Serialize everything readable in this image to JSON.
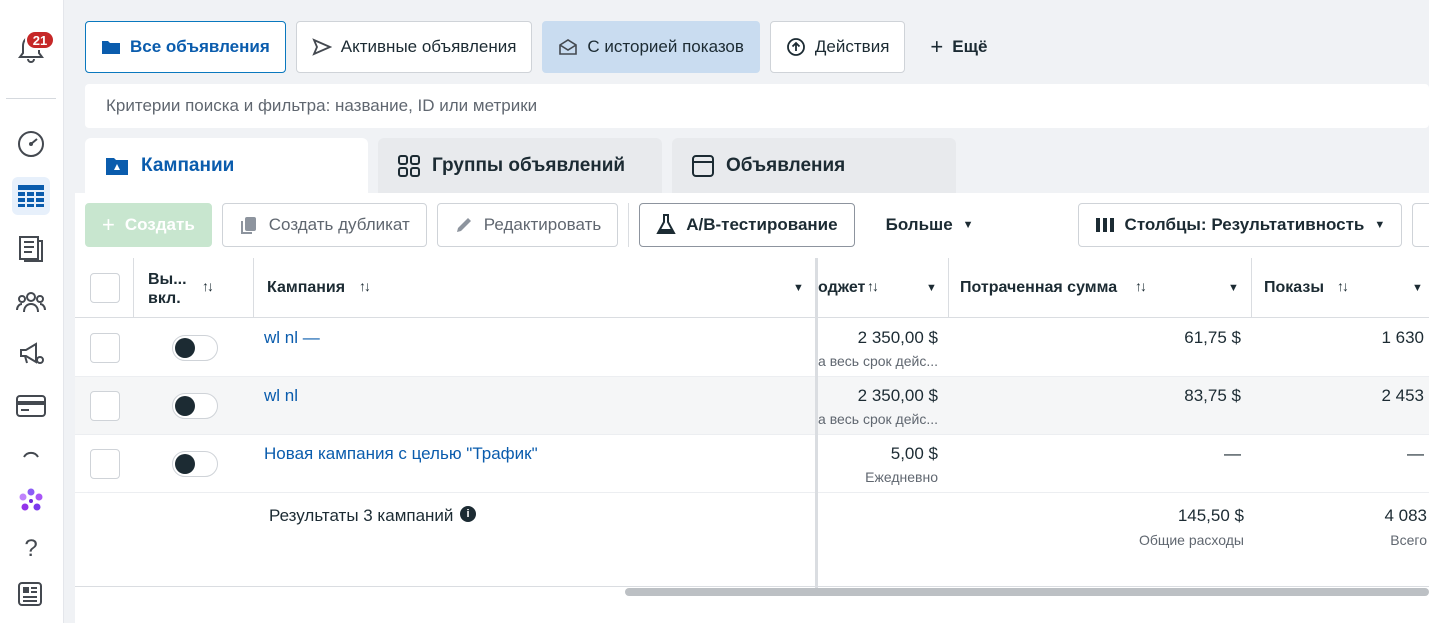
{
  "rail": {
    "notification_count": "21"
  },
  "view_tabs": [
    {
      "label": "Все объявления"
    },
    {
      "label": "Активные объявления"
    },
    {
      "label": "С историей показов"
    },
    {
      "label": "Действия"
    },
    {
      "label": "Ещё"
    }
  ],
  "search": {
    "placeholder": "Критерии поиска и фильтра: название, ID или метрики"
  },
  "level_tabs": [
    {
      "label": "Кампании"
    },
    {
      "label": "Группы объявлений"
    },
    {
      "label": "Объявления"
    }
  ],
  "toolbar": {
    "create_label": "Создать",
    "duplicate_label": "Создать дубликат",
    "edit_label": "Редактировать",
    "ab_test_label": "A/B-тестирование",
    "more_label": "Больше",
    "columns_label": "Столбцы: Результативность"
  },
  "table": {
    "headers": {
      "onoff": "Вы... вкл.",
      "campaign": "Кампания",
      "budget": "оджет",
      "spent": "Потраченная сумма",
      "impressions": "Показы"
    },
    "rows": [
      {
        "name": "wl nl —",
        "budget": "2 350,00 $",
        "budget_sub": "а весь срок дейс...",
        "spent": "61,75 $",
        "impressions": "1 630"
      },
      {
        "name": "wl nl",
        "budget": "2 350,00 $",
        "budget_sub": "а весь срок дейс...",
        "spent": "83,75 $",
        "impressions": "2 453"
      },
      {
        "name": "Новая кампания с целью \"Трафик\"",
        "budget": "5,00 $",
        "budget_sub": "Ежедневно",
        "spent": "—",
        "impressions": "—"
      }
    ],
    "summary": {
      "label": "Результаты 3 кампаний",
      "spent": "145,50 $",
      "spent_sub": "Общие расходы",
      "impressions": "4 083",
      "impressions_sub": "Всего"
    }
  },
  "colors": {
    "accent": "#0a5cad",
    "selected_border": "#0a78be",
    "highlight_tab": "#c9dcf0",
    "badge": "#c62828",
    "create_disabled": "#c8e6cf"
  }
}
